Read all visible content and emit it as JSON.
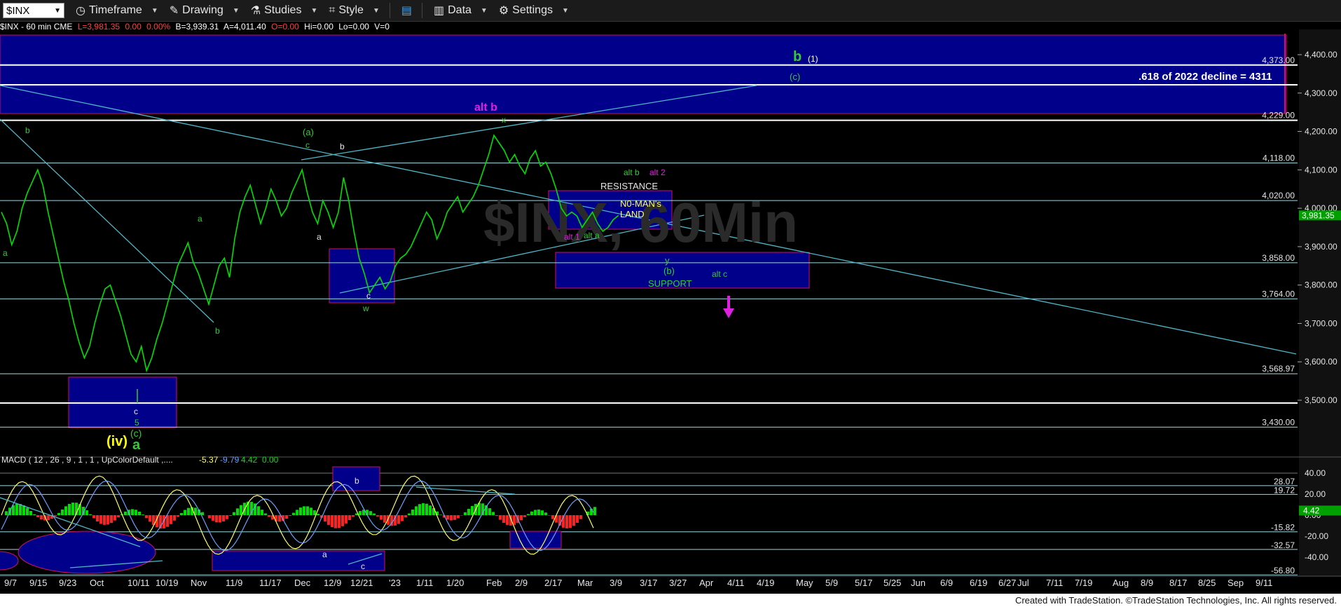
{
  "toolbar": {
    "symbol": "$INX",
    "timeframe": "Timeframe",
    "drawing": "Drawing",
    "studies": "Studies",
    "style": "Style",
    "data": "Data",
    "settings": "Settings"
  },
  "infobar": {
    "symbol": "$INX - 60 min  CME",
    "last": "L=3,981.35",
    "chg": "0.00",
    "pct": "0.00%",
    "bid": "B=3,939.31",
    "ask": "A=4,011.40",
    "open": "O=0.00",
    "hi": "Hi=0.00",
    "lo": "Lo=0.00",
    "vol": "V=0"
  },
  "watermark": "$INX, 60Min",
  "footer": "Created with TradeStation. ©TradeStation Technologies, Inc. All rights reserved.",
  "colors": {
    "price": "#00e000",
    "box": "#00008b",
    "trendline": "#4fb6c8",
    "macd_pos": "#00e000",
    "macd_neg": "#ff2020",
    "magenta": "#e020e0",
    "wave_green": "#33cc33",
    "wave_yellow": "#ffff00"
  },
  "chart_data": [
    {
      "type": "line",
      "panel": "price",
      "ylim": [
        3380,
        4480
      ],
      "yticks": [
        "4,400.00",
        "4,300.00",
        "4,200.00",
        "4,100.00",
        "4,000.00",
        "3,900.00",
        "3,800.00",
        "3,700.00",
        "3,600.00",
        "3,500.00"
      ],
      "xticks": [
        "9/7",
        "9/15",
        "9/23",
        "Oct",
        "10/11",
        "10/19",
        "Nov",
        "11/9",
        "11/17",
        "Dec",
        "12/9",
        "12/21",
        "'23",
        "1/11",
        "1/20",
        "Feb",
        "2/9",
        "2/17",
        "Mar",
        "3/9",
        "3/17",
        "3/27",
        "Apr",
        "4/11",
        "4/19",
        "May",
        "5/9",
        "5/17",
        "5/25",
        "Jun",
        "6/9",
        "6/19",
        "6/27",
        "Jul",
        "7/11",
        "7/19",
        "Aug",
        "8/9",
        "8/17",
        "8/25",
        "Sep",
        "9/11"
      ],
      "series": [
        {
          "x": [
            0,
            1,
            2,
            3,
            4,
            5,
            6,
            7,
            8,
            9,
            10,
            11,
            12,
            13,
            14,
            15,
            16,
            17,
            18,
            19,
            20,
            21,
            22,
            23,
            24,
            25,
            26,
            27,
            28,
            29,
            30,
            31,
            32,
            33,
            34,
            35,
            36,
            37,
            38,
            39,
            40,
            41,
            42,
            43,
            44,
            45,
            46,
            47,
            48,
            49,
            50,
            51,
            52,
            53,
            54,
            55,
            56,
            57,
            58,
            59,
            60,
            61,
            62,
            63,
            64,
            65,
            66,
            67,
            68,
            69,
            70,
            71,
            72,
            73,
            74,
            75,
            76,
            77,
            78,
            79,
            80,
            81,
            82,
            83,
            84,
            85,
            86,
            87,
            88,
            89,
            90,
            91,
            92,
            93,
            94,
            95,
            96,
            97,
            98,
            99,
            100,
            101,
            102,
            103,
            104,
            105,
            106,
            107,
            108,
            109,
            110,
            111,
            112,
            113,
            114,
            115,
            116,
            117,
            118,
            119,
            120,
            121,
            122,
            123,
            124,
            125,
            126,
            127,
            128,
            129,
            130
          ],
          "y": [
            3990,
            3960,
            3905,
            3940,
            4000,
            4040,
            4070,
            4100,
            4060,
            3990,
            3930,
            3870,
            3810,
            3760,
            3700,
            3650,
            3610,
            3640,
            3700,
            3750,
            3790,
            3800,
            3760,
            3720,
            3670,
            3620,
            3600,
            3640,
            3577,
            3610,
            3660,
            3700,
            3750,
            3800,
            3850,
            3880,
            3910,
            3860,
            3830,
            3790,
            3750,
            3800,
            3850,
            3870,
            3820,
            3920,
            3990,
            4030,
            4060,
            4010,
            3960,
            4000,
            4050,
            4020,
            3980,
            4000,
            4040,
            4070,
            4100,
            4040,
            3990,
            3960,
            4020,
            3990,
            3950,
            3990,
            4080,
            4020,
            3940,
            3870,
            3830,
            3780,
            3800,
            3820,
            3790,
            3810,
            3850,
            3870,
            3880,
            3900,
            3930,
            3960,
            3990,
            3970,
            3920,
            3950,
            3990,
            4010,
            4030,
            3990,
            4010,
            4030,
            4060,
            4100,
            4140,
            4190,
            4170,
            4150,
            4120,
            4140,
            4110,
            4090,
            4130,
            4150,
            4110,
            4120,
            4090,
            4050,
            4000,
            3980,
            3990,
            3980,
            3950,
            3970,
            3990,
            3960,
            3940,
            3950,
            3970,
            3981,
            null,
            null,
            null,
            null,
            null,
            null,
            null,
            null,
            null,
            null,
            null
          ],
          "name": "$INX"
        }
      ],
      "horizontal_levels": [
        "4,373.00",
        "4,229.00",
        "4,118.00",
        "4,020.00",
        "3,858.00",
        "3,764.00",
        "3,568.97",
        "3,430.00"
      ],
      "last_price": "3,981.35",
      "annotations": {
        "b_top": "b",
        "b_top_1": "(1)",
        "c_top": "(c)",
        "fib": ".618 of 2022 decline = 4311",
        "alt_b_top": "alt b",
        "x": "x",
        "a_paren": "(a)",
        "c_small": "c",
        "b_small": "b",
        "a_small": "a",
        "w": "w",
        "alt_b": "alt b",
        "alt_2": "alt 2",
        "resistance": "RESISTANCE",
        "nomans": "N0-MAN's",
        "land": "LAND",
        "alt_1": "alt 1",
        "alt_a": "alt a",
        "y": "y",
        "b_paren": "(b)",
        "support": "SUPPORT",
        "alt_c": "alt c",
        "five": "5",
        "iv": "(iv)",
        "c_paren": "(c)",
        "a_big": "a"
      }
    },
    {
      "type": "line",
      "panel": "macd",
      "title": "MACD ( 12 , 26 , 9 , 1 , 1 , UpColorDefault ,....",
      "values_readout": [
        "-5.37",
        "-9.79",
        "4.42",
        "0.00"
      ],
      "yticks": [
        "40.00",
        "20.00",
        "0.00",
        "-20.00",
        "-40.00"
      ],
      "horizontal_levels": [
        "28.07",
        "19.72",
        "-15.82",
        "-32.57",
        "-56.80"
      ],
      "last_value": "4.42",
      "annotations": {
        "b": "b",
        "a": "a",
        "c": "c"
      }
    }
  ]
}
